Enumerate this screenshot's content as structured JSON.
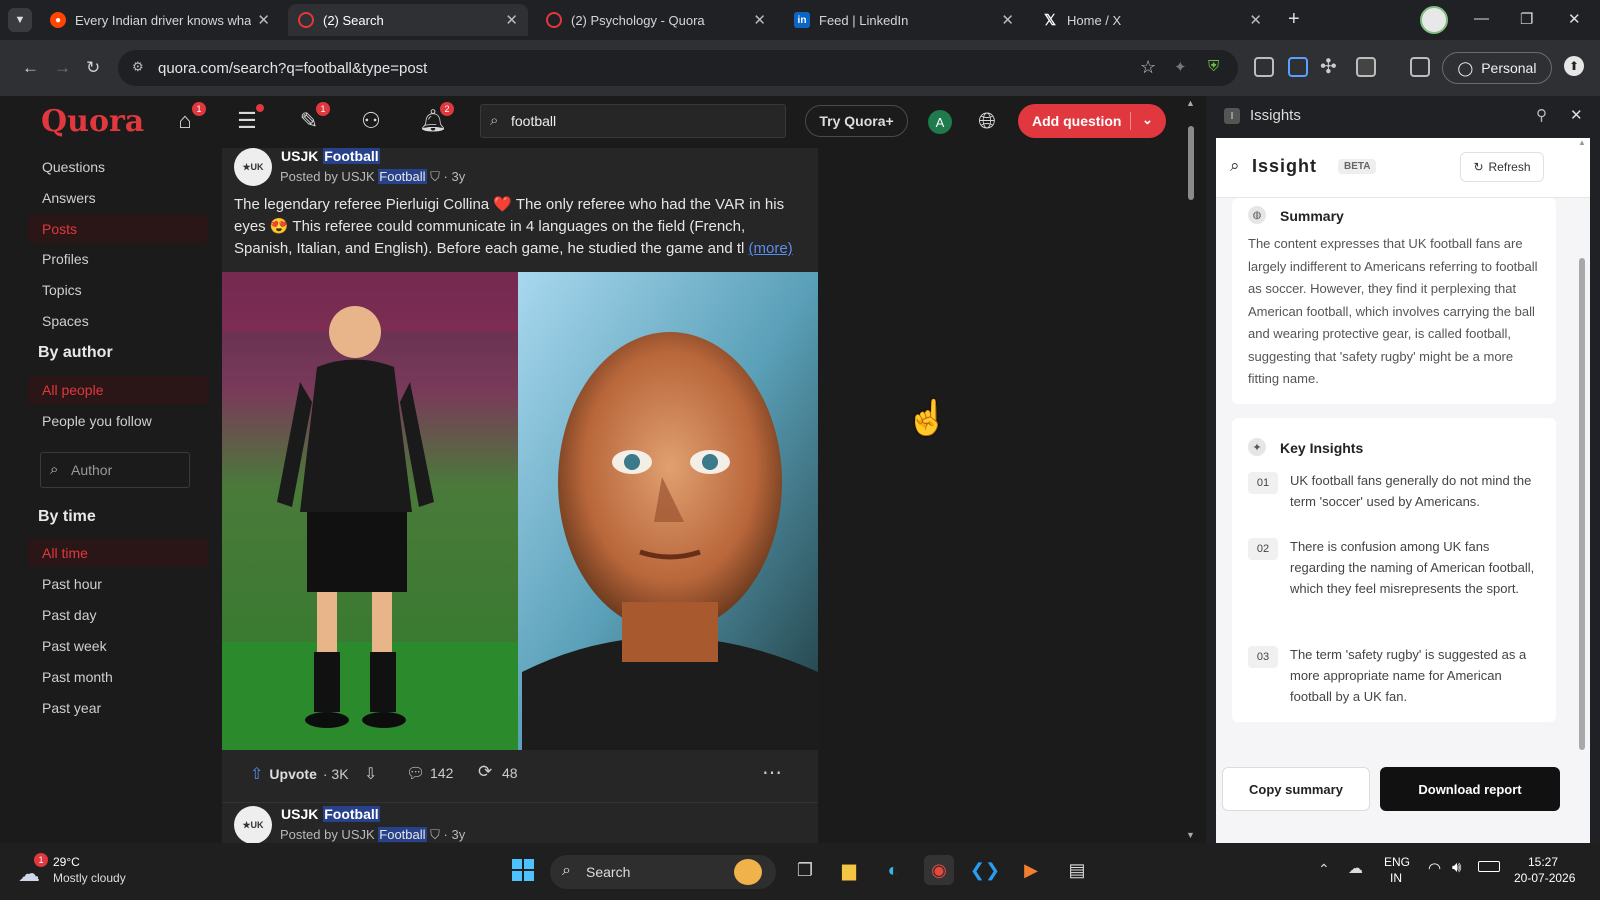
{
  "browser": {
    "tabs": [
      {
        "title": "Every Indian driver knows wha",
        "icon": "reddit-icon",
        "color": "#ff4500"
      },
      {
        "title": "(2) Search",
        "icon": "quora-icon",
        "color": "#b92b27"
      },
      {
        "title": "(2) Psychology - Quora",
        "icon": "quora-icon",
        "color": "#b92b27"
      },
      {
        "title": "Feed | LinkedIn",
        "icon": "linkedin-icon",
        "color": "#0a66c2"
      },
      {
        "title": "Home / X",
        "icon": "x-icon",
        "color": "#000000"
      }
    ],
    "url": "quora.com/search?q=football&type=post",
    "profile_label": "Personal"
  },
  "quora": {
    "logo": "Quora",
    "badges": {
      "home": "1",
      "answer": "1",
      "notifications": "2"
    },
    "search_value": "football",
    "try_label": "Try Quora+",
    "avatar_letter": "A",
    "add_question_label": "Add question",
    "accent_color": "#e0383e"
  },
  "filters": {
    "types": [
      "Questions",
      "Answers",
      "Posts",
      "Profiles",
      "Topics",
      "Spaces"
    ],
    "selected_type": "Posts",
    "by_author_heading": "By author",
    "author_options": [
      "All people",
      "People you follow"
    ],
    "selected_author": "All people",
    "author_placeholder": "Author",
    "by_time_heading": "By time",
    "time_options": [
      "All time",
      "Past hour",
      "Past day",
      "Past week",
      "Past month",
      "Past year"
    ],
    "selected_time": "All time"
  },
  "posts": [
    {
      "author": "USJK Football",
      "author_prefix": "USJK ",
      "author_highlight": "Football",
      "posted_prefix": "Posted by USJK ",
      "posted_highlight": "Football",
      "age": "· 3y",
      "text": "The legendary referee Pierluigi Collina ❤️ The only referee who had the VAR in his eyes 😍 This referee could communicate in 4 languages on the field (French, Spanish, Italian, and English). Before each game, he studied the game and tl",
      "more_label": "(more)",
      "upvote_label": "Upvote",
      "upvote_count": "· 3K",
      "comments": "142",
      "shares": "48"
    },
    {
      "author_prefix": "USJK ",
      "author_highlight": "Football",
      "posted_prefix": "Posted by USJK ",
      "posted_highlight": "Football",
      "age": "· 3y"
    }
  ],
  "insight": {
    "panel_title": "Issights",
    "brand": "Issight",
    "beta": "BETA",
    "refresh_label": "Refresh",
    "summary_title": "Summary",
    "summary_text": "The content expresses that UK football fans are largely indifferent to Americans referring to football as soccer. However, they find it perplexing that American football, which involves carrying the ball and wearing protective gear, is called football, suggesting that 'safety rugby' might be a more fitting name.",
    "key_title": "Key Insights",
    "insights": [
      {
        "num": "01",
        "text": "UK football fans generally do not mind the term 'soccer' used by Americans."
      },
      {
        "num": "02",
        "text": "There is confusion among UK fans regarding the naming of American football, which they feel misrepresents the sport."
      },
      {
        "num": "03",
        "text": "The term 'safety rugby' is suggested as a more appropriate name for American football by a UK fan."
      }
    ],
    "copy_label": "Copy summary",
    "download_label": "Download report"
  },
  "taskbar": {
    "weather_temp": "29°C",
    "weather_desc": "Mostly cloudy",
    "weather_badge": "1",
    "search_label": "Search",
    "lang_top": "ENG",
    "lang_bottom": "IN",
    "time": "15:27",
    "date": "20-07-2026"
  }
}
